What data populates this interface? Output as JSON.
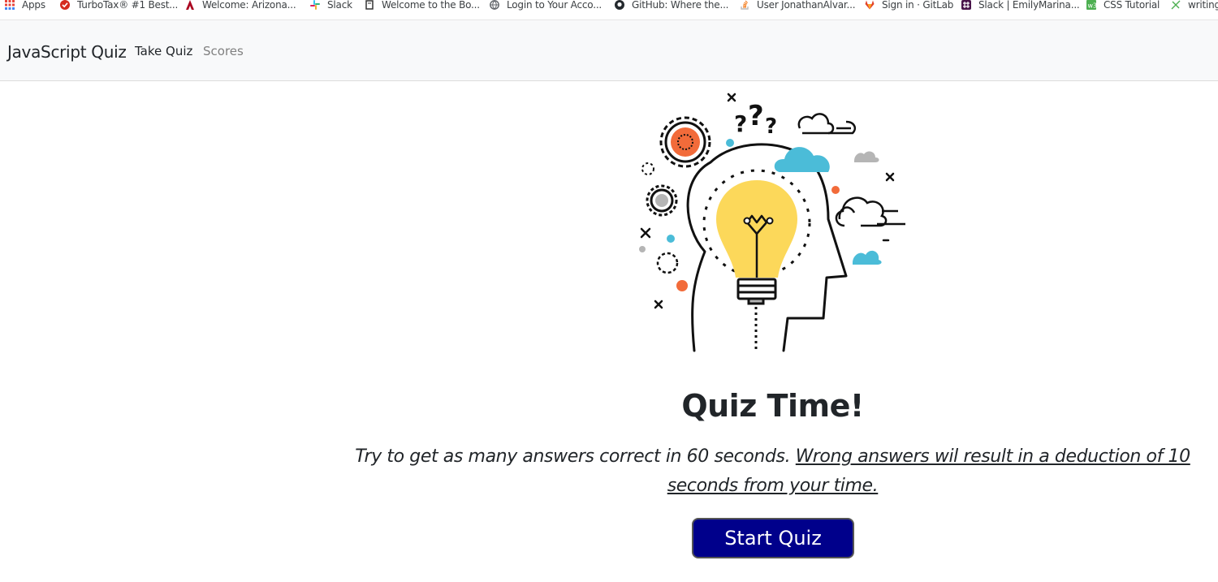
{
  "bookmarks": [
    {
      "label": "Apps",
      "icon": "apps-grid-icon"
    },
    {
      "label": "TurboTax® #1 Best...",
      "icon": "turbotax-icon"
    },
    {
      "label": "Welcome: Arizona...",
      "icon": "arizona-icon"
    },
    {
      "label": "Slack",
      "icon": "slack-icon"
    },
    {
      "label": "Welcome to the Bo...",
      "icon": "book-icon"
    },
    {
      "label": "Login to Your Acco...",
      "icon": "globe-icon"
    },
    {
      "label": "GitHub: Where the...",
      "icon": "github-icon"
    },
    {
      "label": "User JonathanAlvar...",
      "icon": "stackoverflow-icon"
    },
    {
      "label": "Sign in · GitLab",
      "icon": "gitlab-icon"
    },
    {
      "label": "Slack | EmilyMarina...",
      "icon": "slack-workspace-icon"
    },
    {
      "label": "CSS Tutorial",
      "icon": "w3schools-icon"
    },
    {
      "label": "writing",
      "icon": "writing-icon"
    }
  ],
  "navbar": {
    "brand": "JavaScript Quiz",
    "take_quiz": "Take Quiz",
    "scores": "Scores"
  },
  "hero": {
    "image": "lightbulb-head-icon"
  },
  "main": {
    "title": "Quiz Time!",
    "instructions": "Try to get as many answers correct in 60 seconds.",
    "warning": "Wrong answers wil result in a deduction of 10 seconds from your time.",
    "start_button": "Start Quiz"
  },
  "colors": {
    "navbar_bg": "#f8f9fa",
    "button_bg": "#00008b",
    "bulb_yellow": "#fcd85a",
    "accent_orange": "#f26b3a",
    "accent_blue": "#4bbcd8",
    "accent_gray": "#b5b5b5"
  }
}
